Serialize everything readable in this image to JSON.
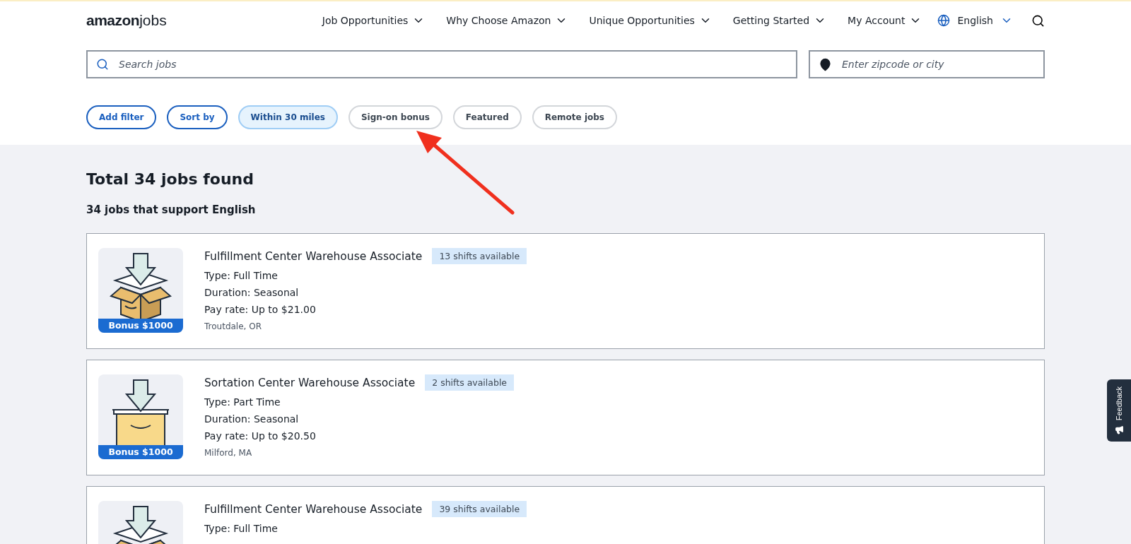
{
  "header": {
    "logo": {
      "word1": "amazon",
      "word2": "jobs"
    },
    "nav": [
      {
        "label": "Job Opportunities"
      },
      {
        "label": "Why Choose Amazon"
      },
      {
        "label": "Unique Opportunities"
      },
      {
        "label": "Getting Started"
      },
      {
        "label": "My Account"
      }
    ],
    "language": "English"
  },
  "search": {
    "placeholder": "Search jobs"
  },
  "location": {
    "placeholder": "Enter zipcode or city"
  },
  "filters": [
    {
      "label": "Add filter",
      "kind": "action",
      "selected": false
    },
    {
      "label": "Sort by",
      "kind": "action",
      "selected": false
    },
    {
      "label": "Within 30 miles",
      "kind": "toggle",
      "selected": true
    },
    {
      "label": "Sign-on bonus",
      "kind": "toggle",
      "selected": false
    },
    {
      "label": "Featured",
      "kind": "toggle",
      "selected": false
    },
    {
      "label": "Remote jobs",
      "kind": "toggle",
      "selected": false
    }
  ],
  "results": {
    "title": "Total 34 jobs found",
    "subtitle": "34 jobs that support English"
  },
  "jobs": [
    {
      "kind": "open-box",
      "bonus": "Bonus $1000",
      "title": "Fulfillment Center Warehouse Associate",
      "shifts": "13 shifts available",
      "details": [
        "Type: Full Time",
        "Duration: Seasonal",
        "Pay rate: Up to $21.00"
      ],
      "location": "Troutdale, OR"
    },
    {
      "kind": "bin",
      "bonus": "Bonus $1000",
      "title": "Sortation Center Warehouse Associate",
      "shifts": "2 shifts available",
      "details": [
        "Type: Part Time",
        "Duration: Seasonal",
        "Pay rate: Up to $20.50"
      ],
      "location": "Milford, MA"
    },
    {
      "kind": "open-box",
      "title": "Fulfillment Center Warehouse Associate",
      "shifts": "39 shifts available",
      "details": [
        "Type: Full Time"
      ]
    }
  ],
  "feedback": {
    "label": "Feedback"
  },
  "annotation": {
    "kind": "arrow"
  }
}
